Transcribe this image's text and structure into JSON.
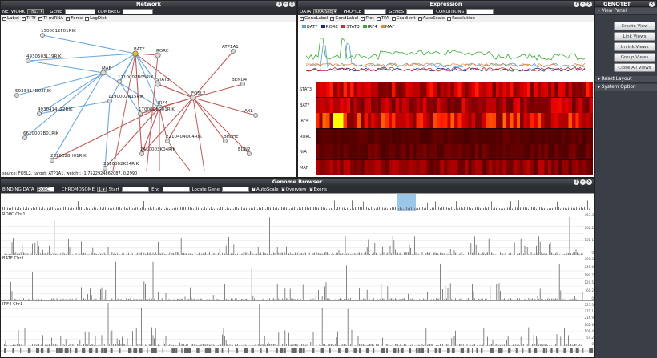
{
  "network": {
    "title": "Network",
    "network_label": "NETWORK",
    "network_value": "Th17",
    "gene_label": "GENE",
    "combreg_label": "COMBREG",
    "toggles": [
      {
        "label": "Label",
        "on": true
      },
      {
        "label": "Tf-Tf",
        "on": true
      },
      {
        "label": "Tf-miRNA",
        "on": true
      },
      {
        "label": "Force",
        "on": true
      },
      {
        "label": "LogDist",
        "on": true
      }
    ],
    "status": "source: FOSL2, target: ATP1A1, weight: -1.7522924862087, 0.2990",
    "nodes": [
      {
        "label": "1500012F01RIK"
      },
      {
        "label": "4930503L19RIK"
      },
      {
        "label": "MAF"
      },
      {
        "label": "BATF"
      },
      {
        "label": "RORC"
      },
      {
        "label": "ATP1A1"
      },
      {
        "label": "1110002B05RIK"
      },
      {
        "label": "STAT3"
      },
      {
        "label": "BEND4"
      },
      {
        "label": "5033414D02RIK"
      },
      {
        "label": "1190002N15RIK"
      },
      {
        "label": "IRF4"
      },
      {
        "label": "FOSL2"
      },
      {
        "label": "4930414L22RIK"
      },
      {
        "label": "1700001G01RIK"
      },
      {
        "label": "AXL"
      },
      {
        "label": "6610007B01RIK"
      },
      {
        "label": "2210404O04RIK"
      },
      {
        "label": "BHLHE"
      },
      {
        "label": "2410003K04RIK"
      },
      {
        "label": "2610028H01RIK"
      },
      {
        "label": "2310002K24RIK"
      },
      {
        "label": "EDN2"
      }
    ]
  },
  "expression": {
    "title": "Expression",
    "data_label": "DATA",
    "data_value": "RNA-Seq",
    "profile_label": "PROFILE",
    "genes_label": "GENES",
    "conditions_label": "CONDITIONS",
    "toggles": [
      {
        "label": "GeneLabel",
        "on": true
      },
      {
        "label": "CondLabel",
        "on": true
      },
      {
        "label": "Plot",
        "on": true
      },
      {
        "label": "TFA",
        "on": true
      },
      {
        "label": "Gradient",
        "on": true
      },
      {
        "label": "AutoScale",
        "on": true
      },
      {
        "label": "Resolution",
        "on": false
      }
    ],
    "legend": [
      {
        "name": "BATF",
        "color": "#5aa0d8"
      },
      {
        "name": "RORC",
        "color": "#1a2a80"
      },
      {
        "name": "STAT3",
        "color": "#c0303a"
      },
      {
        "name": "IRF4",
        "color": "#38a838"
      },
      {
        "name": "MAF",
        "color": "#e88830"
      }
    ],
    "heatmap_rows": [
      "STAT3",
      "BATF",
      "IRF4",
      "RORC",
      "N/A",
      "MAF"
    ],
    "heat_levels": [
      0.45,
      0.4,
      0.6,
      0.1,
      0.15,
      0.3
    ]
  },
  "genome": {
    "title": "Genome Browser",
    "binding_label": "BINDING DATA",
    "binding_value": "RORC",
    "chromosome_label": "CHROMOSOME",
    "chromosome_value": "1",
    "start_label": "Start",
    "end_label": "End",
    "locate_label": "Locate Gene",
    "toggles": [
      {
        "label": "AutoScale",
        "on": true
      },
      {
        "label": "Overview",
        "on": true
      },
      {
        "label": "Exons",
        "on": true
      }
    ],
    "tracks": [
      {
        "name": "RORC Chr1",
        "ticks": [
          "453.3",
          "302.2",
          "151.1",
          "0"
        ]
      },
      {
        "name": "BATF Chr1",
        "ticks": [
          "301.3",
          "241.0",
          "180.7",
          "120.5",
          "60.2",
          "0"
        ]
      },
      {
        "name": "IRF4 Chr1",
        "ticks": [
          "325.3",
          "271.1",
          "216.9",
          "162.6",
          "108.4",
          "54.2",
          "0"
        ]
      }
    ]
  },
  "side": {
    "title": "GENOTET",
    "view_panel": "View Panel",
    "buttons": [
      "Create View",
      "Link Views",
      "Unlink Views",
      "Group Views",
      "Close All Views"
    ],
    "reset_layout": "Reset Layout",
    "system_option": "System Option"
  }
}
